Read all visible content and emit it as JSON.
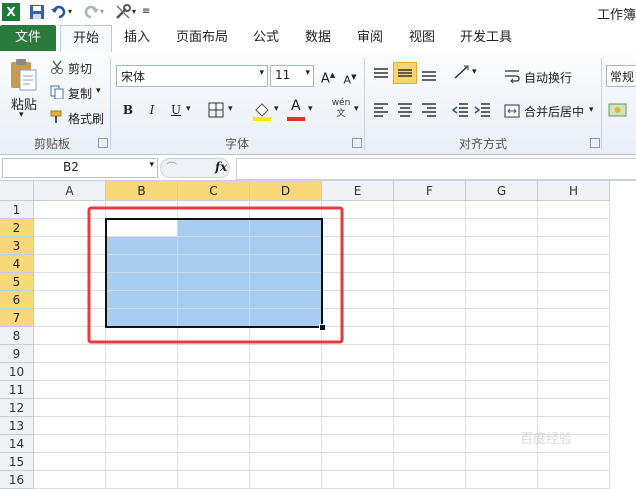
{
  "window": {
    "title": "工作簿"
  },
  "ribbon_tabs": [
    "文件",
    "开始",
    "插入",
    "页面布局",
    "公式",
    "数据",
    "审阅",
    "视图",
    "开发工具"
  ],
  "clipboard": {
    "paste": "粘贴",
    "cut": "剪切",
    "copy": "复制",
    "format_painter": "格式刷",
    "group": "剪贴板"
  },
  "font": {
    "name": "宋体",
    "size": "11",
    "group": "字体",
    "bold": "B",
    "italic": "I",
    "underline": "U",
    "text_color_letter": "A",
    "phonetic": "wén\n文"
  },
  "alignment": {
    "wrap": "自动换行",
    "merge": "合并后居中",
    "group": "对齐方式"
  },
  "number": {
    "format": "常规"
  },
  "formula_bar": {
    "name_box": "B2",
    "fx": "fx",
    "value": ""
  },
  "grid": {
    "columns": [
      "A",
      "B",
      "C",
      "D",
      "E",
      "F",
      "G",
      "H"
    ],
    "rows": [
      "1",
      "2",
      "3",
      "4",
      "5",
      "6",
      "7",
      "8",
      "9",
      "10",
      "11",
      "12",
      "13",
      "14",
      "15",
      "16"
    ],
    "selected_columns": [
      "B",
      "C",
      "D"
    ],
    "selected_rows": [
      "2",
      "3",
      "4",
      "5",
      "6",
      "7"
    ],
    "selection_range": "B2:D7",
    "active_cell": "B2"
  },
  "watermark": "百度经验",
  "colors": {
    "file_tab": "#2a7a3b",
    "selection": "#a8cdf0",
    "header_highlight": "#f9d87a",
    "annotation": "#e8393c"
  }
}
